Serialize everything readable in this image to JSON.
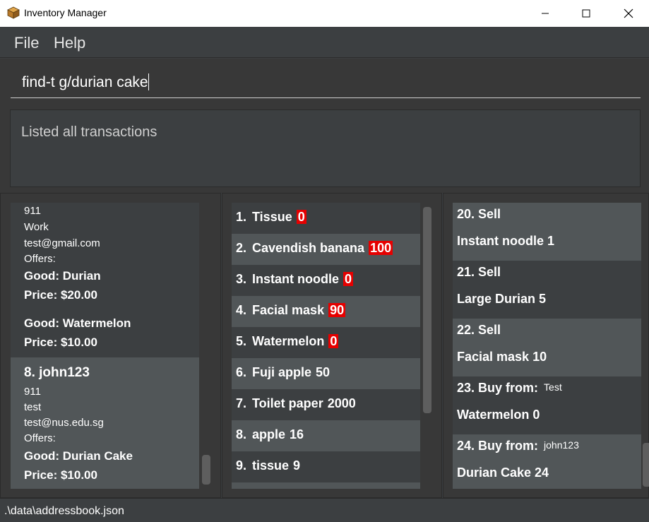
{
  "window": {
    "title": "Inventory Manager",
    "icon": "box-icon"
  },
  "menu": {
    "items": [
      "File",
      "Help"
    ]
  },
  "command": {
    "value": "find-t g/durian cake"
  },
  "result": {
    "message": "Listed all transactions"
  },
  "persons": {
    "partial": {
      "phone": "911",
      "address": "Work",
      "email": "test@gmail.com",
      "offers_label": "Offers:",
      "offers": [
        {
          "good": "Good: Durian",
          "price": "Price: $20.00"
        },
        {
          "good": "Good: Watermelon",
          "price": "Price: $10.00"
        }
      ]
    },
    "card8": {
      "index_name": "8.  john123",
      "phone": "911",
      "address": "test",
      "email": "test@nus.edu.sg",
      "offers_label": "Offers:",
      "offers": [
        {
          "good": "Good: Durian Cake",
          "price": "Price: $10.00"
        }
      ]
    }
  },
  "goods": [
    {
      "index": "1.",
      "name": "Tissue",
      "qty": "0",
      "low": true
    },
    {
      "index": "2.",
      "name": "Cavendish banana",
      "qty": "100",
      "low": true
    },
    {
      "index": "3.",
      "name": "Instant noodle",
      "qty": "0",
      "low": true
    },
    {
      "index": "4.",
      "name": "Facial mask",
      "qty": "90",
      "low": true
    },
    {
      "index": "5.",
      "name": "Watermelon",
      "qty": "0",
      "low": true
    },
    {
      "index": "6.",
      "name": "Fuji apple",
      "qty": "50",
      "low": false
    },
    {
      "index": "7.",
      "name": "Toilet paper",
      "qty": "2000",
      "low": false
    },
    {
      "index": "8.",
      "name": "apple",
      "qty": "16",
      "low": false
    },
    {
      "index": "9.",
      "name": "tissue",
      "qty": "9",
      "low": false
    }
  ],
  "transactions": [
    {
      "head": "20.  Sell",
      "party": "",
      "good": "Instant noodle 1"
    },
    {
      "head": "21.  Sell",
      "party": "",
      "good": "Large Durian 5"
    },
    {
      "head": "22.  Sell",
      "party": "",
      "good": "Facial mask 10"
    },
    {
      "head": "23.  Buy from:",
      "party": "Test",
      "good": "Watermelon 0"
    },
    {
      "head": "24.  Buy from:",
      "party": "john123",
      "good": "Durian Cake 24"
    }
  ],
  "status": {
    "path": ".\\data\\addressbook.json"
  },
  "colors": {
    "background": "#3c3f41",
    "card_light": "#515658",
    "low_stock": "#e60000"
  }
}
